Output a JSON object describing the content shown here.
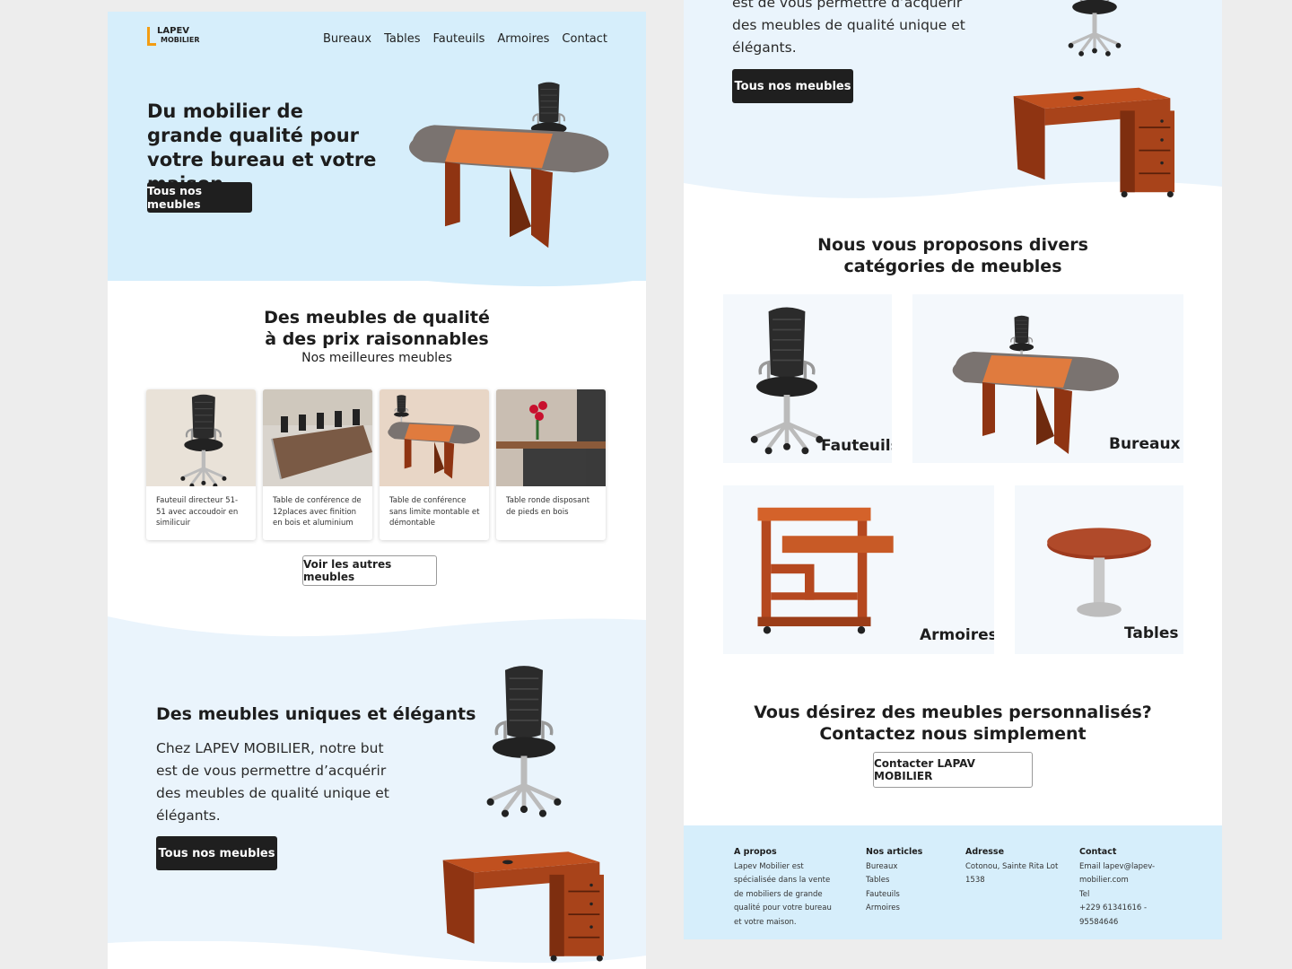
{
  "brand": {
    "line1": "LAPEV",
    "line2": "MOBILIER",
    "accent": "#f39c12"
  },
  "nav": [
    "Bureaux",
    "Tables",
    "Fauteuils",
    "Armoires",
    "Contact"
  ],
  "hero": {
    "title": "Du mobilier de grande qualité pour votre bureau et votre maison",
    "cta": "Tous nos meubles"
  },
  "quality": {
    "title_line1": "Des meubles de qualité",
    "title_line2": "à des prix raisonnables",
    "subtitle": "Nos meilleures meubles",
    "products": [
      {
        "name": "Fauteuil directeur 51-51 avec accoudoir en similicuir",
        "icon": "office-chair"
      },
      {
        "name": "Table de conférence de 12places avec finition en bois et aluminium",
        "icon": "conference-table"
      },
      {
        "name": "Table de conférence sans limite montable et démontable",
        "icon": "conference-table"
      },
      {
        "name": "Table ronde disposant de pieds en bois",
        "icon": "round-table"
      }
    ],
    "more_button": "Voir les autres meubles"
  },
  "unique": {
    "title": "Des meubles uniques et élégants",
    "text": "Chez LAPEV MOBILIER, notre but est de vous permettre d’acquérir des meubles de qualité unique et élégants.",
    "text_cropped": "est de vous permettre d’acquérir des meubles de qualité unique et élégants.",
    "cta": "Tous nos meubles"
  },
  "categories": {
    "title_line1": "Nous vous proposons divers",
    "title_line2": "catégories de meubles",
    "items": [
      "Fauteuils",
      "Bureaux",
      "Armoires",
      "Tables"
    ]
  },
  "custom": {
    "title_line1": "Vous désirez des meubles personnalisés?",
    "title_line2": "Contactez nous simplement",
    "cta": "Contacter LAPAV MOBILIER"
  },
  "footer": {
    "about": {
      "heading": "A propos",
      "text": "Lapev Mobilier est spécialisée dans la vente de mobiliers de grande qualité pour votre bureau et votre maison."
    },
    "articles": {
      "heading": "Nos articles",
      "items": [
        "Bureaux",
        "Tables",
        "Fauteuils",
        "Armoires"
      ]
    },
    "address": {
      "heading": "Adresse",
      "text": "Cotonou, Sainte Rita Lot 1538"
    },
    "contact": {
      "heading": "Contact",
      "email": "Email lapev@lapev-mobilier.com",
      "tel_label": "Tel",
      "tel": "+229 61341616 - 95584646"
    }
  },
  "colors": {
    "hero_bg": "#d6eefb",
    "band_bg": "#eaf4fc",
    "wood": "#b5481f",
    "dark_btn": "#1f1f1f"
  }
}
